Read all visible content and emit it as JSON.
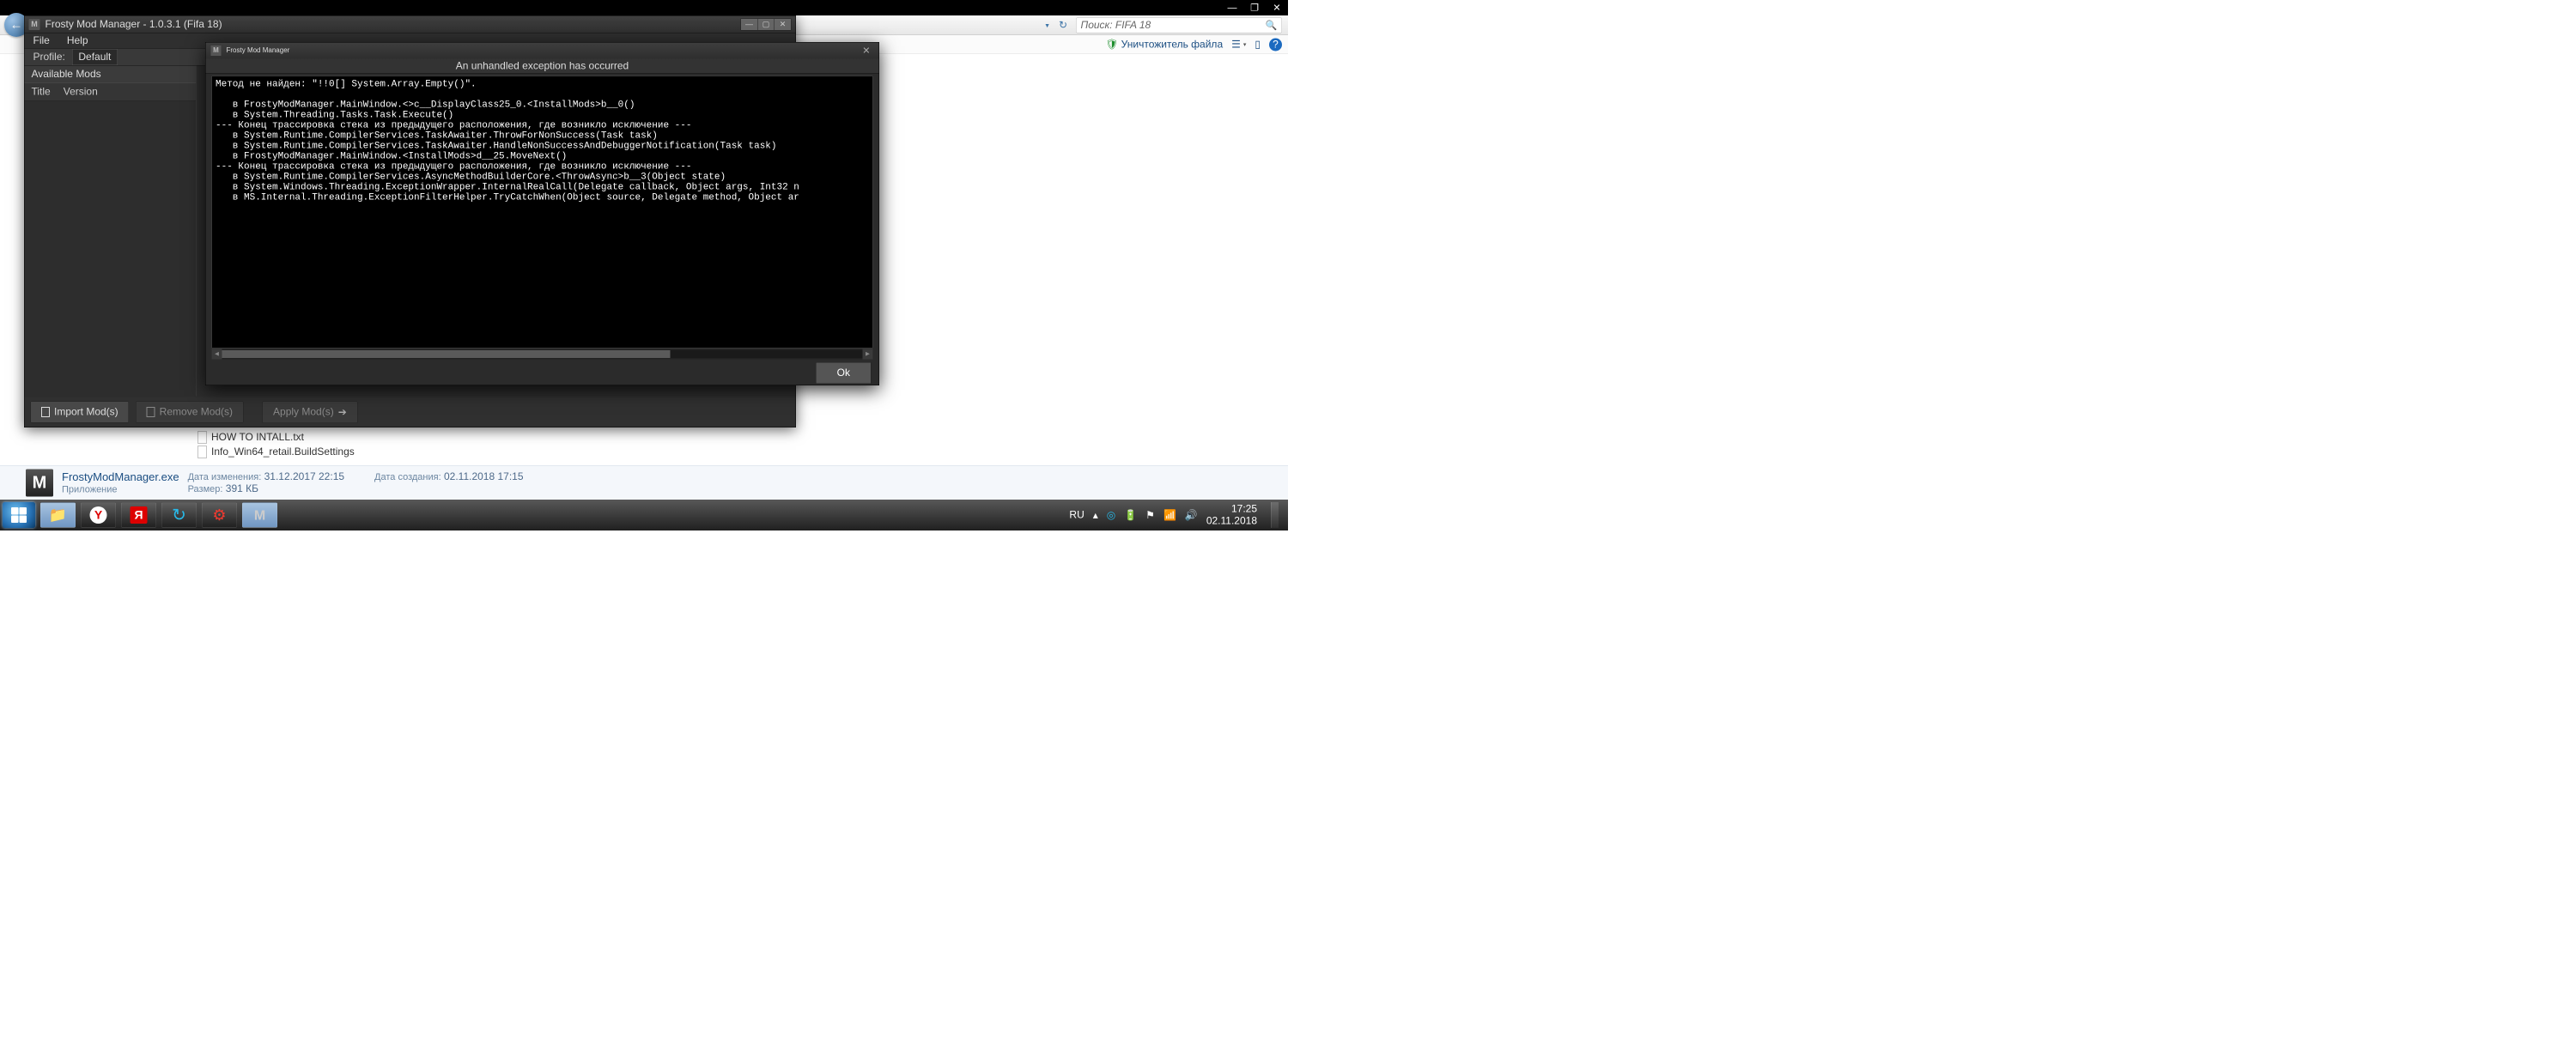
{
  "browser_top": {
    "min": "—",
    "max": "❐",
    "close": "✕"
  },
  "toolbar1": {
    "back_glyph": "←",
    "search_placeholder": "Поиск: FIFA 18",
    "refresh": "↻"
  },
  "toolbar2": {
    "destroyer": "Уничтожитель файла",
    "help_glyph": "?"
  },
  "frosty": {
    "title": "Frosty Mod Manager - 1.0.3.1 (Fifa 18)",
    "menu_file": "File",
    "menu_help": "Help",
    "profile_label": "Profile:",
    "profile_value": "Default",
    "available_mods": "Available Mods",
    "col_title": "Title",
    "col_version": "Version",
    "btn_import": "Import Mod(s)",
    "btn_remove": "Remove Mod(s)",
    "btn_apply": "Apply Mod(s)"
  },
  "error": {
    "title": "Frosty Mod Manager",
    "header": "An unhandled exception has occurred",
    "ok": "Ok",
    "trace": "Метод не найден: \"!!0[] System.Array.Empty()\".\n\n   в FrostyModManager.MainWindow.<>c__DisplayClass25_0.<InstallMods>b__0()\n   в System.Threading.Tasks.Task.Execute()\n--- Конец трассировка стека из предыдущего расположения, где возникло исключение ---\n   в System.Runtime.CompilerServices.TaskAwaiter.ThrowForNonSuccess(Task task)\n   в System.Runtime.CompilerServices.TaskAwaiter.HandleNonSuccessAndDebuggerNotification(Task task)\n   в FrostyModManager.MainWindow.<InstallMods>d__25.MoveNext()\n--- Конец трассировка стека из предыдущего расположения, где возникло исключение ---\n   в System.Runtime.CompilerServices.AsyncMethodBuilderCore.<ThrowAsync>b__3(Object state)\n   в System.Windows.Threading.ExceptionWrapper.InternalRealCall(Delegate callback, Object args, Int32 n\n   в MS.Internal.Threading.ExceptionFilterHelper.TryCatchWhen(Object source, Delegate method, Object ar"
  },
  "files": {
    "f1": "HOW TO INTALL.txt",
    "f2": "Info_Win64_retail.BuildSettings"
  },
  "details": {
    "name": "FrostyModManager.exe",
    "type": "Приложение",
    "mod_label": "Дата изменения:",
    "mod_value": "31.12.2017 22:15",
    "size_label": "Размер:",
    "size_value": "391 КБ",
    "created_label": "Дата создания:",
    "created_value": "02.11.2018 17:15"
  },
  "taskbar": {
    "lang": "RU",
    "time": "17:25",
    "date": "02.11.2018"
  }
}
